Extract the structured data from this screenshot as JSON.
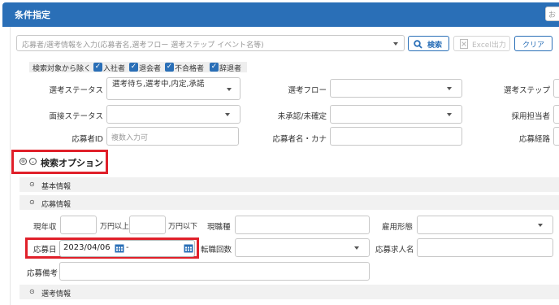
{
  "header": {
    "title": "条件指定",
    "corner_button": "お"
  },
  "search": {
    "placeholder": "応募者/選考情報を入力(応募者名,選考フロー 選考ステップ イベント名等)",
    "search_label": "検索",
    "excel_label": "Excel出力",
    "clear_label": "クリア"
  },
  "exclude": {
    "label": "検索対象から除く",
    "items": [
      {
        "label": "入社者",
        "checked": true
      },
      {
        "label": "退会者",
        "checked": true
      },
      {
        "label": "不合格者",
        "checked": true
      },
      {
        "label": "辞退者",
        "checked": true
      }
    ]
  },
  "fields": {
    "senko_status_label": "選考ステータス",
    "senko_status_value": "選考待ち,選考中,内定,承諾",
    "senko_flow_label": "選考フロー",
    "senko_step_label": "選考ステップ",
    "mensetsu_status_label": "面接ステータス",
    "unconfirmed_label": "未承認/未確定",
    "saiyou_tantou_label": "採用担当者",
    "applicant_id_label": "応募者ID",
    "applicant_id_placeholder": "複数入力可",
    "applicant_name_label": "応募者名・カナ",
    "route_label": "応募経路"
  },
  "options": {
    "title": "検索オプション",
    "basic_info": "基本情報",
    "apply_info": "応募情報",
    "senko_info": "選考情報"
  },
  "apply": {
    "salary_label": "現年収",
    "salary_from_suffix": "万円以上",
    "salary_to_suffix": "万円以下",
    "current_job_label": "現職種",
    "employment_label": "雇用形態",
    "apply_date_label": "応募日",
    "apply_date_from": "2023/04/06",
    "apply_date_sep": "-",
    "job_change_label": "転職回数",
    "job_title_label": "応募求人名",
    "remarks_label": "応募備考"
  },
  "colors": {
    "accent": "#2a6fb7",
    "highlight": "#e0202a"
  }
}
